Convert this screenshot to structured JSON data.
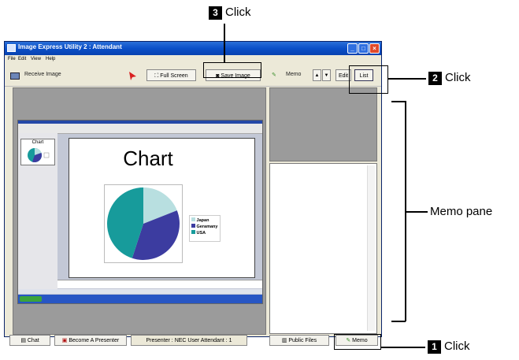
{
  "window": {
    "title": "Image Express Utility 2 : Attendant",
    "minimize": "_",
    "maximize": "□",
    "close": "×"
  },
  "menu": [
    "File",
    "Edit",
    "View",
    "Help"
  ],
  "toolbar": {
    "receive_image": "Receive Image",
    "full_screen": "Full Screen",
    "save_image": "Save Image",
    "memo": "Memo",
    "edit": "Edit",
    "list": "List"
  },
  "slide": {
    "title": "Chart",
    "thumb_title": "Chart",
    "legend": [
      "Japan",
      "Geramany",
      "USA"
    ]
  },
  "chart_data": {
    "type": "pie",
    "title": "Chart",
    "categories": [
      "Japan",
      "Geramany",
      "USA"
    ],
    "values": [
      19,
      36,
      45
    ]
  },
  "colors": {
    "japan": "#b8dfe0",
    "germany": "#3c3ca0",
    "usa": "#179b9b"
  },
  "statusbar": {
    "chat": "Chat",
    "become_presenter": "Become A Presenter",
    "presenter_info": "Presenter : NEC User   Attendant : 1",
    "public_files": "Public Files",
    "memo": "Memo"
  },
  "callouts": {
    "one": {
      "num": "1",
      "text": "Click"
    },
    "two": {
      "num": "2",
      "text": "Click"
    },
    "three": {
      "num": "3",
      "text": "Click"
    },
    "memo_pane": "Memo pane"
  }
}
